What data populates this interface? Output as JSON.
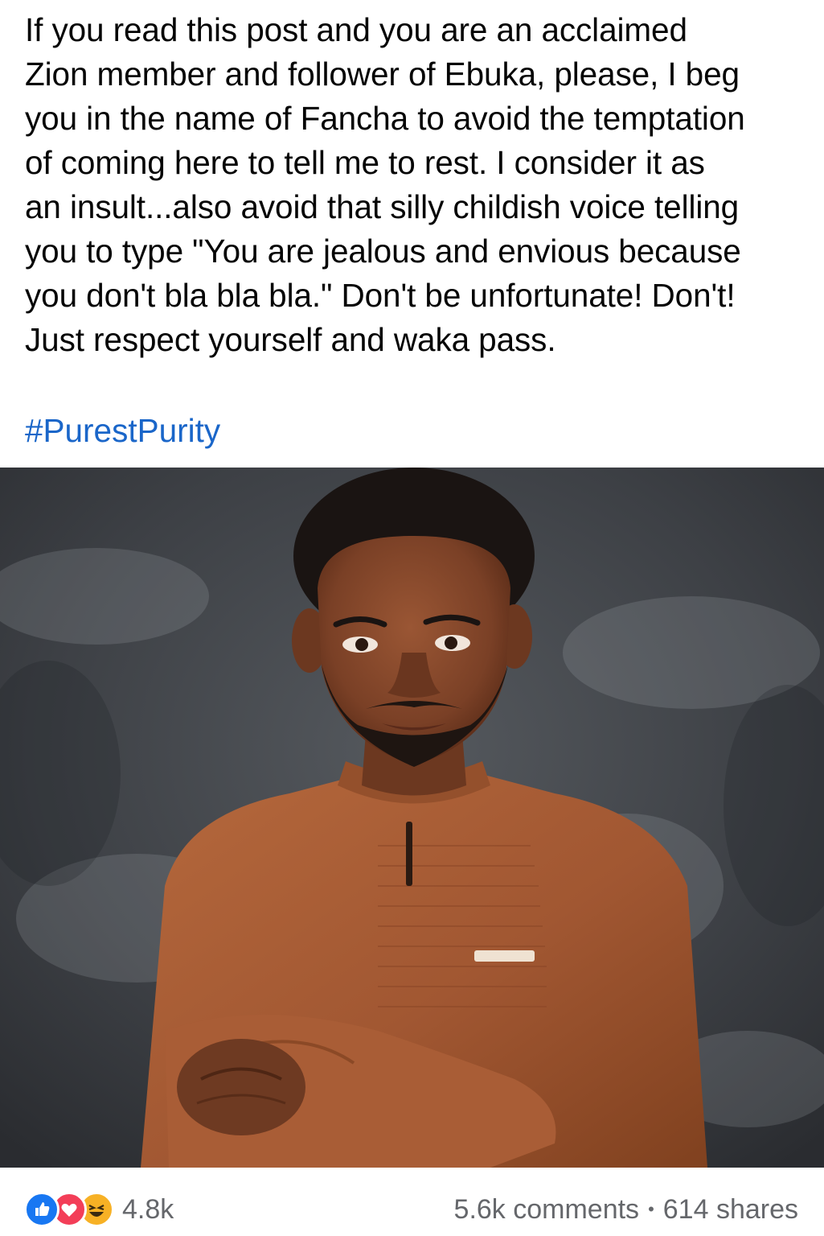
{
  "post": {
    "text_lines": [
      "If you read this post and you are an acclaimed",
      "Zion member and follower of Ebuka, please, I beg",
      "you in the name of Fancha to avoid the temptation",
      "of coming here to tell me to rest. I consider it as",
      "an insult...also avoid that silly childish voice telling",
      "you to type \"You are jealous and envious because",
      "you don't bla bla bla.\" Don't be unfortunate! Don't!",
      "Just respect yourself and waka pass."
    ],
    "hashtag": "#PurestPurity"
  },
  "photo": {
    "subject": "portrait of man in brown native attire with arms crossed",
    "colors": {
      "backdrop": "#3c3f43",
      "shirt": "#a45a33",
      "skin": "#7a4026",
      "hair": "#1a1412"
    }
  },
  "footer": {
    "reactions": [
      {
        "icon": "like-reaction-icon",
        "color": "#1877f2"
      },
      {
        "icon": "love-reaction-icon",
        "color": "#f33e58"
      },
      {
        "icon": "haha-reaction-icon",
        "color": "#f7b125"
      }
    ],
    "reaction_count": "4.8k",
    "comments": "5.6k comments",
    "separator": "•",
    "shares": "614 shares"
  },
  "colors": {
    "text": "#050505",
    "hashtag": "#1a66c9",
    "muted": "#65676b"
  }
}
